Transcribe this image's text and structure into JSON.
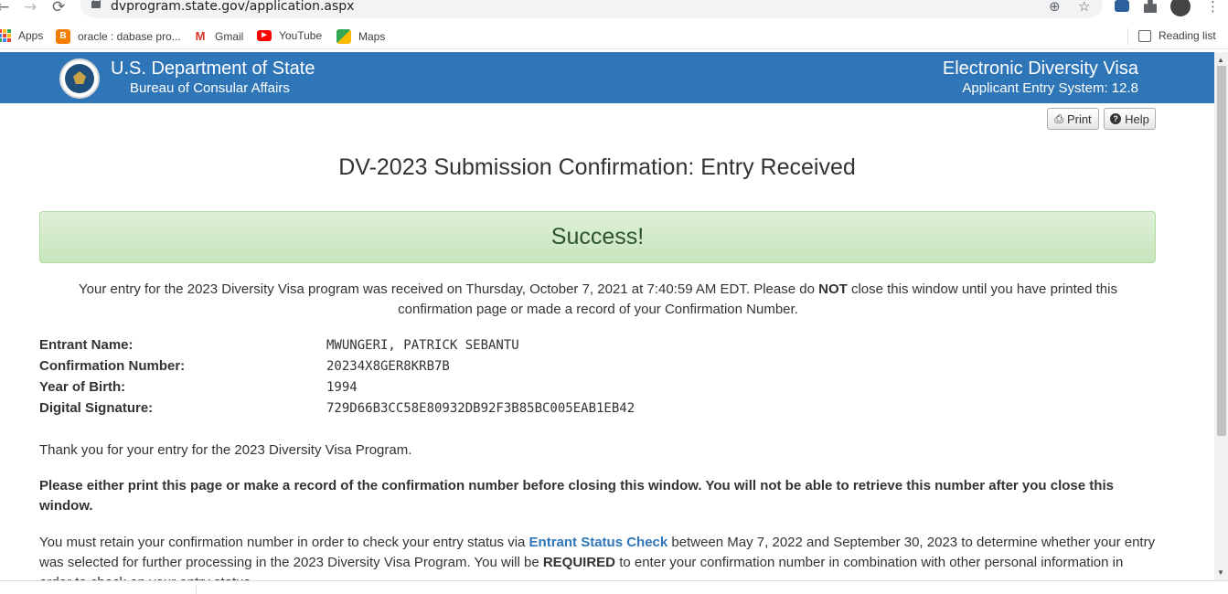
{
  "browser": {
    "back": "←",
    "forward": "→",
    "reload": "⟳",
    "url": "dvprogram.state.gov/application.aspx",
    "zoom_icon": "⊕",
    "star_icon": "☆",
    "menu_icon": "⋮",
    "bookmarks": [
      {
        "label": "Apps",
        "icon": "apps-icon"
      },
      {
        "label": "oracle : dabase pro...",
        "icon": "blogger-icon"
      },
      {
        "label": "Gmail",
        "icon": "gmail-icon"
      },
      {
        "label": "YouTube",
        "icon": "youtube-icon"
      },
      {
        "label": "Maps",
        "icon": "maps-icon"
      }
    ],
    "reading_list": "Reading list"
  },
  "header": {
    "department": "U.S. Department of State",
    "bureau": "Bureau of Consular Affairs",
    "system_title": "Electronic Diversity Visa",
    "system_subtitle": "Applicant Entry System: 12.8",
    "brand_color": "#2f76b8"
  },
  "toolbar": {
    "print_label": "Print",
    "help_label": "Help"
  },
  "page": {
    "title": "DV-2023 Submission Confirmation: Entry Received",
    "success_label": "Success!",
    "received_part1": "Your entry for the 2023 Diversity Visa program was received on Thursday, October 7, 2021 at 7:40:59 AM EDT. Please do ",
    "received_emphasis": "NOT",
    "received_part2": " close this window until you have printed this confirmation page or made a record of your Confirmation Number.",
    "details": [
      {
        "label": "Entrant Name:",
        "value": "MWUNGERI, PATRICK SEBANTU"
      },
      {
        "label": "Confirmation Number:",
        "value": "20234X8GER8KRB7B"
      },
      {
        "label": "Year of Birth:",
        "value": "1994"
      },
      {
        "label": "Digital Signature:",
        "value": "729D66B3CC58E80932DB92F3B85BC005EAB1EB42"
      }
    ],
    "thanks": "Thank you for your entry for the 2023 Diversity Visa Program.",
    "warning": "Please either print this page or make a record of the confirmation number before closing this window. You will not be able to retrieve this number after you close this window.",
    "retain_part1": "You must retain your confirmation number in order to check your entry status via ",
    "retain_link": "Entrant Status Check",
    "retain_part2": " between May 7, 2022 and September 30, 2023 to determine whether your entry was selected for further processing in the 2023 Diversity Visa Program. You will be ",
    "retain_emphasis": "REQUIRED",
    "retain_part3": " to enter your confirmation number in combination with other personal information in order to check on your entry status."
  }
}
